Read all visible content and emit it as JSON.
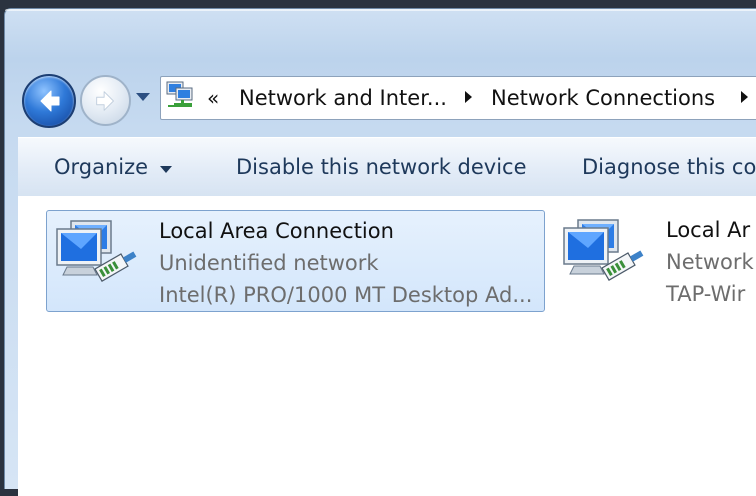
{
  "navigation": {
    "back_icon": "back-arrow-icon",
    "forward_icon": "forward-arrow-icon",
    "history_icon": "chevron-down-icon"
  },
  "address_bar": {
    "icon": "network-connections-icon",
    "overflow": "«",
    "crumbs": [
      "Network and Inter...",
      "Network Connections"
    ]
  },
  "toolbar": {
    "organize_label": "Organize",
    "disable_label": "Disable this network device",
    "diagnose_label": "Diagnose this co"
  },
  "connections": [
    {
      "name": "Local Area Connection",
      "status": "Unidentified network",
      "device": "Intel(R) PRO/1000 MT Desktop Ad...",
      "selected": true
    },
    {
      "name": "Local Ar",
      "status": "Network",
      "device": "TAP-Wir",
      "selected": false
    }
  ],
  "colors": {
    "accent": "#2f79d8",
    "selection": "#d3e6fb",
    "command_text": "#1e395b"
  }
}
